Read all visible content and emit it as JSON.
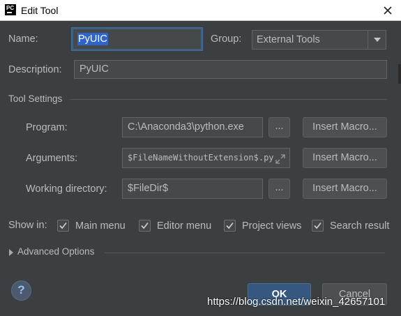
{
  "window": {
    "app_icon_text": "PC",
    "title": "Edit Tool",
    "close_icon": "close-icon"
  },
  "form": {
    "name_label": "Name:",
    "name_value": "PyUIC",
    "group_label": "Group:",
    "group_value": "External Tools",
    "description_label": "Description:",
    "description_value": "PyUIC"
  },
  "tool_settings": {
    "header": "Tool Settings",
    "program_label": "Program:",
    "program_value": "C:\\Anaconda3\\python.exe",
    "arguments_label": "Arguments:",
    "arguments_value": "$FileNameWithoutExtension$.py",
    "working_dir_label": "Working directory:",
    "working_dir_value": "$FileDir$",
    "browse_label": "...",
    "insert_macro_label": "Insert Macro..."
  },
  "show_in": {
    "label": "Show in:",
    "options": [
      {
        "label": "Main menu",
        "checked": true
      },
      {
        "label": "Editor menu",
        "checked": true
      },
      {
        "label": "Project views",
        "checked": true
      },
      {
        "label": "Search result",
        "checked": true
      }
    ]
  },
  "advanced": {
    "label": "Advanced Options"
  },
  "footer": {
    "help_label": "?",
    "ok_label": "OK",
    "cancel_label": "Cancel",
    "watermark": "https://blog.csdn.net/weixin_42657101"
  },
  "colors": {
    "dialog_bg": "#3c3f41",
    "field_bg": "#45494a",
    "ok_button": "#365880",
    "selection": "#2f65ca"
  }
}
